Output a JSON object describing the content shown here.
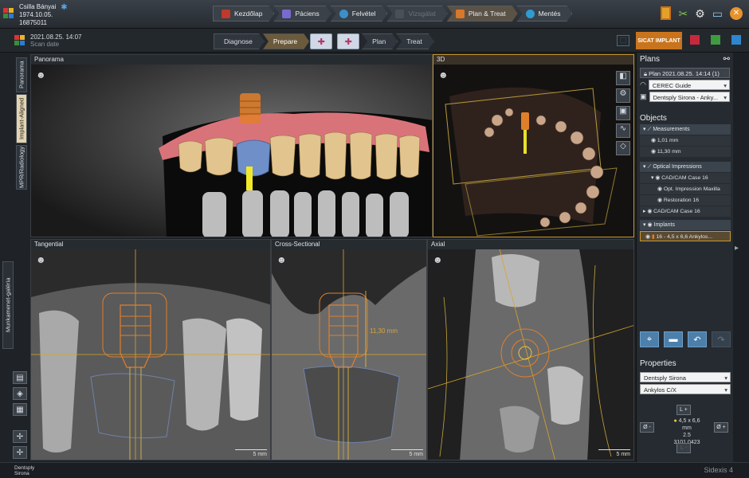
{
  "patient": {
    "name": "Csilla Bányai",
    "dob": "1974.10.05.",
    "id": "16875011"
  },
  "nav_crumbs": [
    {
      "label": "Kezdőlap",
      "state": "normal"
    },
    {
      "label": "Páciens",
      "state": "normal"
    },
    {
      "label": "Felvétel",
      "state": "normal"
    },
    {
      "label": "Vizsgálat",
      "state": "disabled"
    },
    {
      "label": "Plan & Treat",
      "state": "active"
    },
    {
      "label": "Mentés",
      "state": "normal"
    }
  ],
  "scan": {
    "date": "2021.08.25. 14:07",
    "label": "Scan date"
  },
  "workflow": {
    "diagnose": "Diagnose",
    "prepare": "Prepare",
    "plan": "Plan",
    "treat": "Treat"
  },
  "sicat_label": "SICAT IMPLANT",
  "left_tabs": {
    "panorama": "Panorama",
    "implant_aligned": "Implant-Aligned",
    "mpr": "MPR/Radiology",
    "workspace": "Munkamenet-galéria"
  },
  "views": {
    "panorama": "Panorama",
    "three_d": "3D",
    "tangential": "Tangential",
    "cross_sectional": "Cross-Sectional",
    "axial": "Axial",
    "scale": "5 mm",
    "measurement": "11,30 mm"
  },
  "plans": {
    "title": "Plans",
    "current": "Plan 2021.08.25. 14:14 (1)",
    "guide": "CEREC Guide",
    "sleeve": "Dentsply Sirona - Anky..."
  },
  "objects": {
    "title": "Objects",
    "measurements": "Measurements",
    "m1": "1,01 mm",
    "m2": "11,30 mm",
    "optical": "Optical Impressions",
    "case1": "CAD/CAM Case 16",
    "opt_imp": "Opt. Impression Maxilla",
    "restoration": "Restoration 16",
    "case2": "CAD/CAM Case 16",
    "implants": "Implants",
    "implant_item": "16 - 4,5 x 6,6 Ankylos..."
  },
  "properties": {
    "title": "Properties",
    "manufacturer": "Dentsply Sirona",
    "system": "Ankylos C/X",
    "length_plus": "L +",
    "size": "4,5 x 6,6 mm",
    "sub": "2.5",
    "article": "3101 0423",
    "dia_minus": "Ø -",
    "dia_plus": "Ø +",
    "length_minus": "L -"
  },
  "footer": {
    "brand_line1": "Dentsply",
    "brand_line2": "Sirona",
    "product": "Sidexis 4"
  },
  "colors": {
    "accent": "#c8972d",
    "implant": "#e07f2a",
    "guide_line": "#d9a52b"
  }
}
